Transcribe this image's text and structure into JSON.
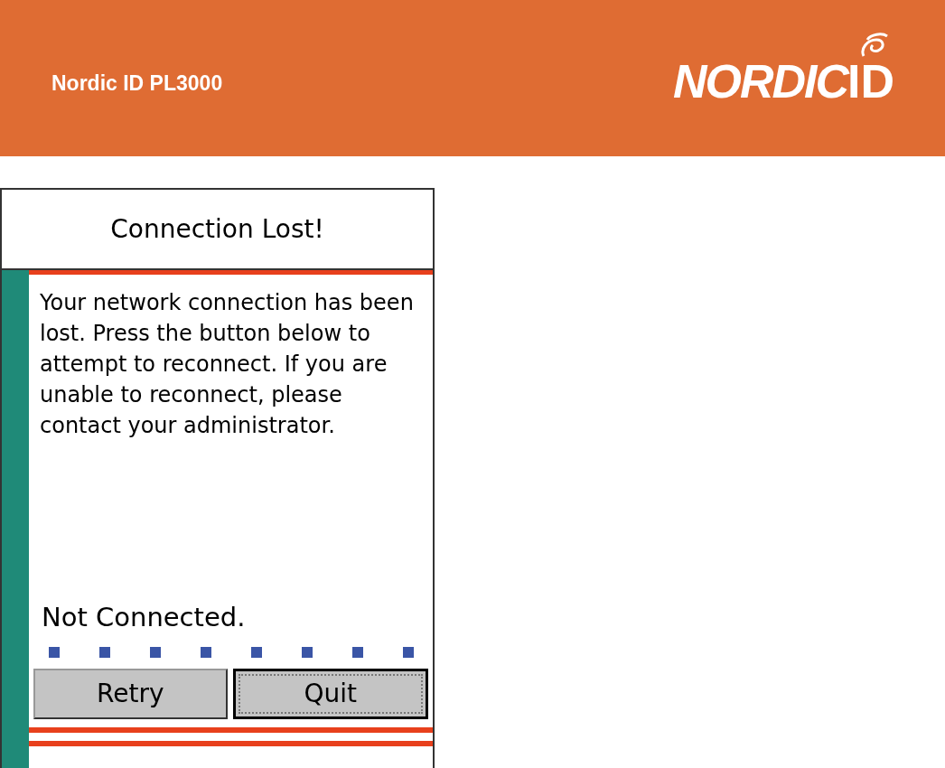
{
  "header": {
    "title": "Nordic ID PL3000",
    "logo": {
      "word": "NORDIC",
      "mark": "ID"
    }
  },
  "dialog": {
    "title": "Connection Lost!",
    "message": "Your network connection has been lost. Press the button below to attempt to reconnect. If you are unable to reconnect, please contact your administrator.",
    "status": "Not Connected.",
    "buttons": [
      {
        "label": "Retry",
        "focused": false
      },
      {
        "label": "Quit",
        "focused": true
      }
    ]
  }
}
